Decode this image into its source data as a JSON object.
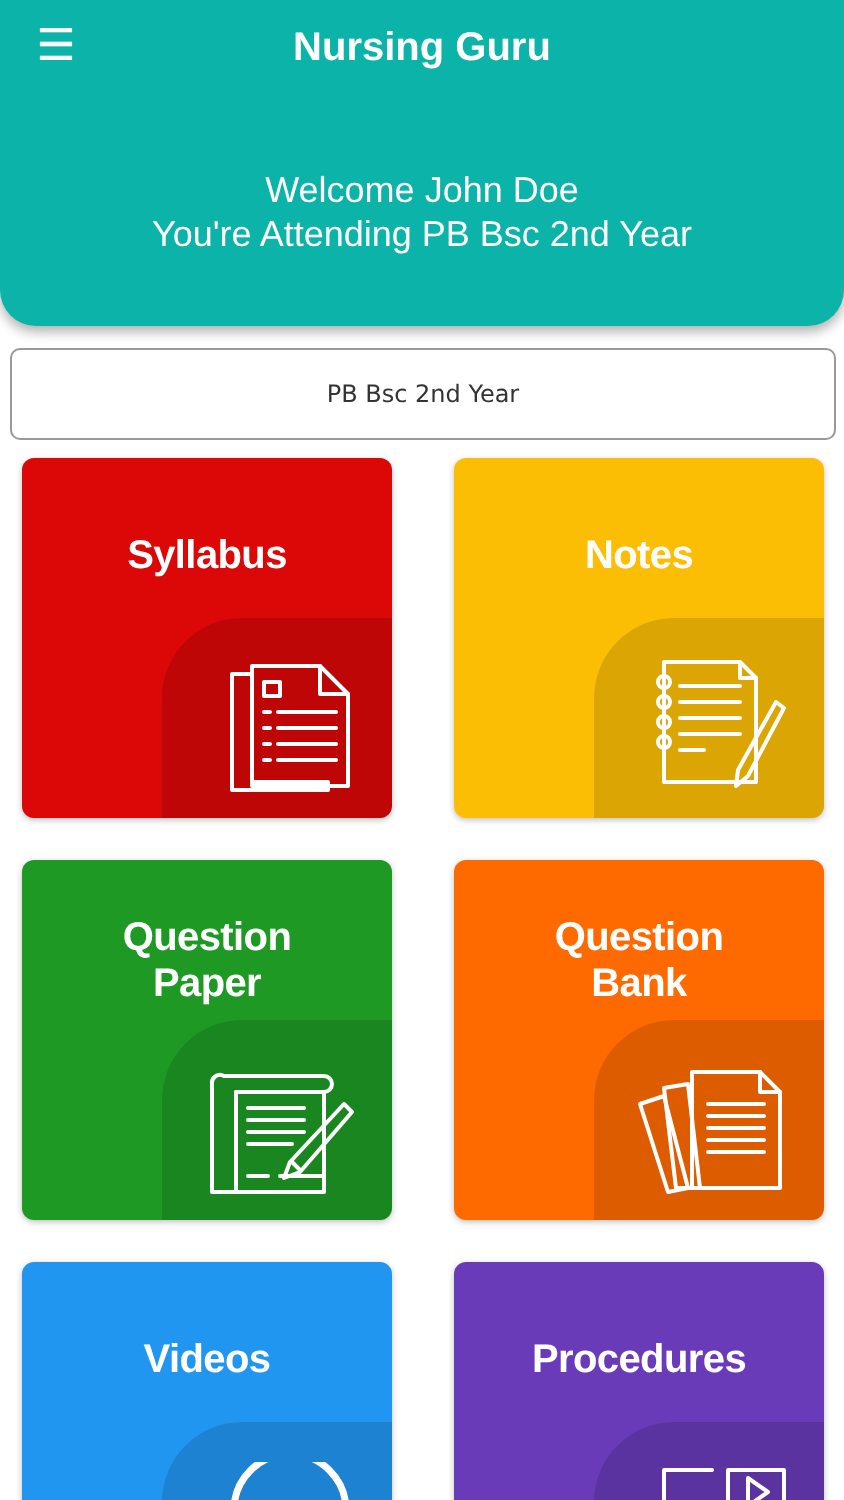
{
  "app_bar": {
    "menu_icon": "☰",
    "title": "Nursing Guru"
  },
  "welcome": {
    "line_1": "Welcome John Doe",
    "line_2": "You're Attending PB Bsc 2nd Year"
  },
  "course_selector": {
    "value": "PB Bsc 2nd Year"
  },
  "tiles": [
    {
      "label": "Syllabus",
      "color": "#dc0707",
      "kind": "syllabus"
    },
    {
      "label": "Notes",
      "color": "#fcbe05",
      "kind": "notes"
    },
    {
      "label": "Question\nPaper",
      "color": "#1e9a24",
      "kind": "paper"
    },
    {
      "label": "Question\nBank",
      "color": "#ff6a00",
      "kind": "bank"
    },
    {
      "label": "Videos",
      "color": "#2196f0",
      "kind": "videos"
    },
    {
      "label": "Procedures",
      "color": "#693bb8",
      "kind": "procedures"
    }
  ]
}
